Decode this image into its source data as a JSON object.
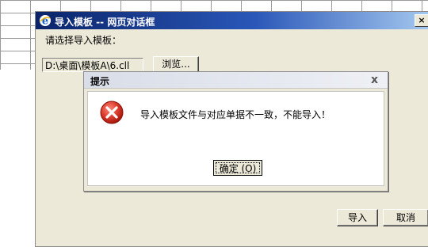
{
  "web_dialog": {
    "title": "导入模板 -- 网页对话框",
    "close_label": "×",
    "choose_label": "请选择导入模板：",
    "file_path_value": "D:\\桌面\\模板A\\6.cll",
    "browse_label": "浏览...",
    "import_label": "导入",
    "cancel_label": "取消"
  },
  "message_box": {
    "title": "提示",
    "close_label": "x",
    "message": "导入模板文件与对应单据不一致，不能导入！",
    "ok_label": "确定 (O)"
  },
  "colors": {
    "title_bar_start": "#0a246a",
    "title_bar_end": "#a6caf0",
    "dialog_face": "#ece9d8",
    "error_icon": "#d93a2b"
  },
  "icons": {
    "title_icon": "ie-icon",
    "message_icon": "error-icon"
  }
}
